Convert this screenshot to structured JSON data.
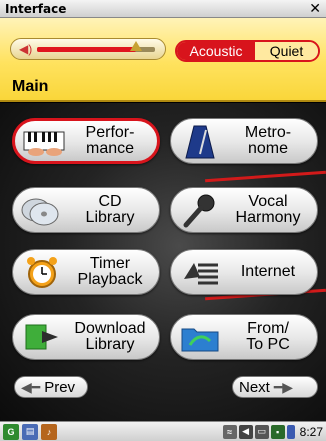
{
  "window": {
    "title": "Interface",
    "close_glyph": "✕"
  },
  "header": {
    "volume": {
      "level": 0.84,
      "icon": "speaker-icon"
    },
    "modes": [
      {
        "label": "Acoustic",
        "active": true
      },
      {
        "label": "Quiet",
        "active": false
      }
    ],
    "section": "Main"
  },
  "menu": {
    "performance": {
      "label": "Perfor-\nmance",
      "icon": "keyboard-icon"
    },
    "metronome": {
      "label": "Metro-\nnome",
      "icon": "metronome-icon"
    },
    "cd_library": {
      "label": "CD\nLibrary",
      "icon": "cd-icon"
    },
    "vocal_harmony": {
      "label": "Vocal\nHarmony",
      "icon": "microphone-icon"
    },
    "timer_playback": {
      "label": "Timer\nPlayback",
      "icon": "alarm-clock-icon"
    },
    "internet": {
      "label": "Internet",
      "icon": "internet-icon"
    },
    "download_library": {
      "label": "Download\nLibrary",
      "icon": "download-icon"
    },
    "from_to_pc": {
      "label": "From/\nTo PC",
      "icon": "folder-transfer-icon"
    }
  },
  "nav": {
    "prev": "Prev",
    "next": "Next"
  },
  "taskbar": {
    "time": "8:27"
  },
  "colors": {
    "accent_red": "#d8141c",
    "header_yellow": "#ffe25e",
    "bg_dark": "#1a1a1a"
  }
}
